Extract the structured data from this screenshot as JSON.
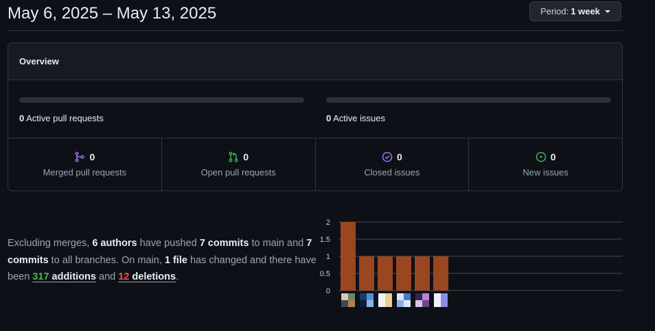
{
  "header": {
    "date_range": "May 6, 2025 – May 13, 2025",
    "period_prefix": "Period:",
    "period_value": "1 week"
  },
  "overview": {
    "title": "Overview",
    "active_pull_requests": {
      "count": "0",
      "label": "Active pull requests"
    },
    "active_issues": {
      "count": "0",
      "label": "Active issues"
    },
    "stats": [
      {
        "icon": "git-merge-icon",
        "value": "0",
        "label": "Merged pull requests",
        "color": "#a371f7"
      },
      {
        "icon": "git-pull-request-icon",
        "value": "0",
        "label": "Open pull requests",
        "color": "#3fb950"
      },
      {
        "icon": "issue-closed-icon",
        "value": "0",
        "label": "Closed issues",
        "color": "#a371f7"
      },
      {
        "icon": "issue-opened-icon",
        "value": "0",
        "label": "New issues",
        "color": "#3fb950"
      }
    ]
  },
  "summary": {
    "t1": "Excluding merges, ",
    "authors": "6 authors",
    "t2": " have pushed ",
    "commits_main": "7 commits",
    "t3": " to main and ",
    "commits_all": "7 commits",
    "t4": " to all branches. On main, ",
    "files": "1 file",
    "t5": " has changed and there have been ",
    "additions_num": "317",
    "additions_word": "additions",
    "t6": " and ",
    "deletions_num": "12",
    "deletions_word": "deletions",
    "t7": "."
  },
  "chart_data": {
    "type": "bar",
    "categories": [
      "author-1",
      "author-2",
      "author-3",
      "author-4",
      "author-5",
      "author-6"
    ],
    "values": [
      2,
      1,
      1,
      1,
      1,
      1
    ],
    "ylim": [
      0,
      2
    ],
    "yticks": [
      "0",
      "0.5",
      "1",
      "1.5",
      "2"
    ],
    "grid": true,
    "bar_color": "#9a4721",
    "x_tick_type": "avatar-images"
  }
}
